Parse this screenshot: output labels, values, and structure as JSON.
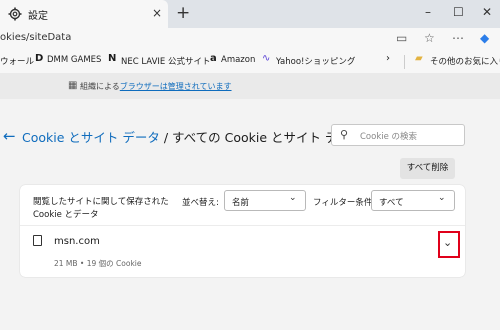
{
  "tab": {
    "title": "設定",
    "close": "×",
    "new_tab": "+"
  },
  "window": {
    "minimize": "–",
    "maximize": "☐",
    "close": "✕"
  },
  "address": {
    "url": "okies/siteData"
  },
  "bookmarks": [
    {
      "label": "ウォール",
      "icon": ""
    },
    {
      "label": "DMM GAMES",
      "icon": "dmm-icon"
    },
    {
      "label": "NEC LAVIE 公式サイト",
      "icon": "nec-icon"
    },
    {
      "label": "Amazon",
      "icon": "amazon-icon"
    },
    {
      "label": "Yahoo!ショッピング",
      "icon": "yahoo-icon"
    },
    {
      "label": "その他のお気に入り",
      "icon": "folder-icon"
    }
  ],
  "managed": {
    "prefix": "組織による",
    "link": "ブラウザーは管理されています"
  },
  "header": {
    "crumb_link": "Cookie とサイト データ",
    "crumb_sep": " / ",
    "crumb_current": "すべての Cookie とサイト データ",
    "search_placeholder": "Cookie の検索",
    "clear_all": "すべて削除"
  },
  "card": {
    "description": "閲覧したサイトに関して保存された Cookie とデータ",
    "sort_label": "並べ替え:",
    "sort_value": "名前",
    "filter_label": "フィルター条件:",
    "filter_value": "すべて",
    "site": {
      "name": "msn.com",
      "meta": "21 MB • 19 個の Cookie"
    }
  },
  "colors": {
    "accent": "#0f6cbd",
    "highlight": "#e0001a"
  }
}
